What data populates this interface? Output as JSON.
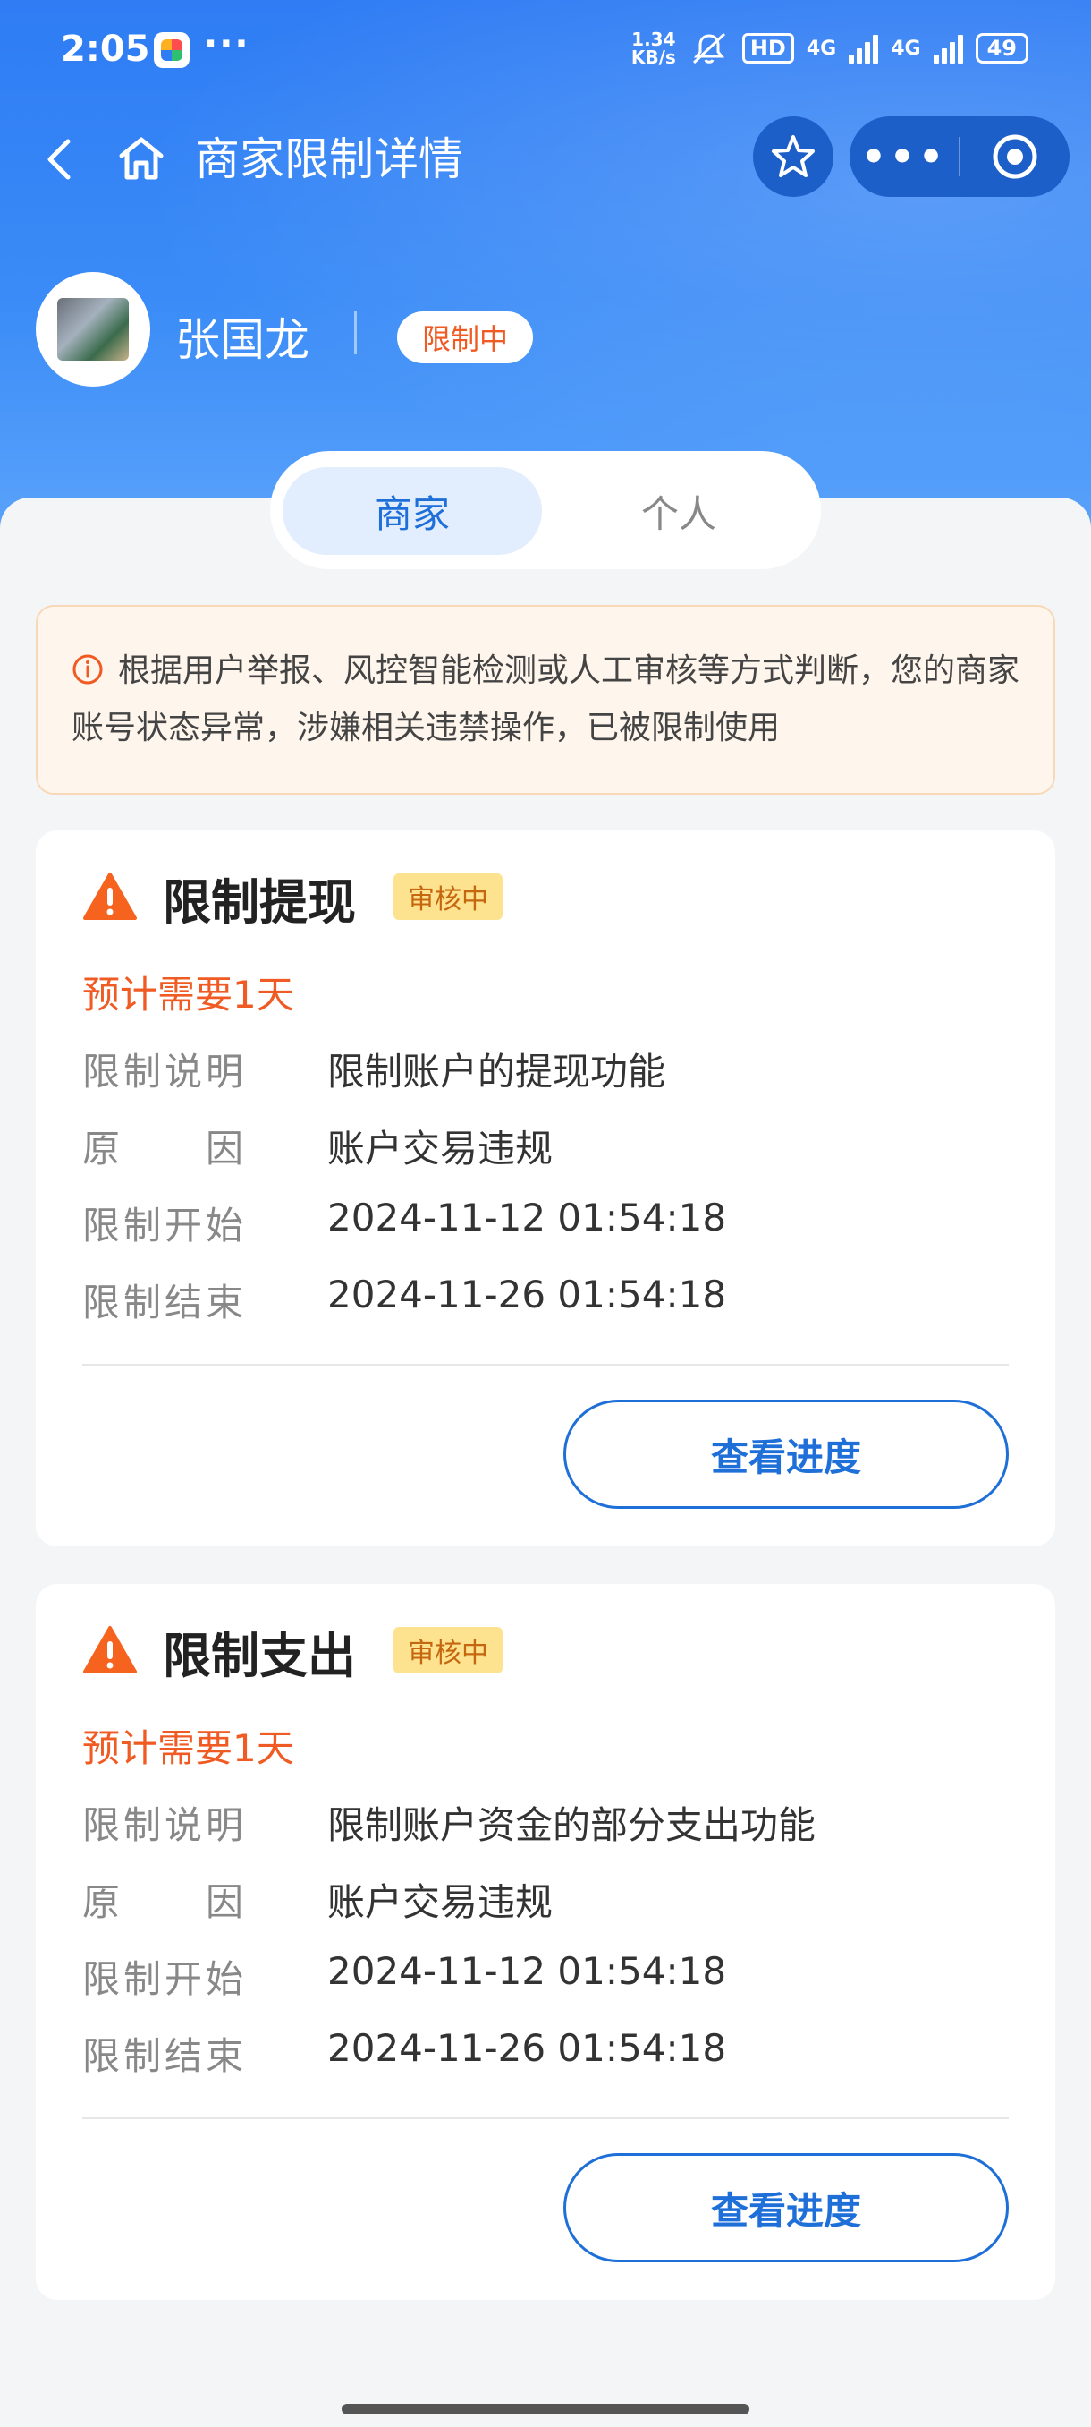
{
  "status_bar": {
    "time": "2:05",
    "more": "···",
    "net_speed_top": "1.34",
    "net_speed_bottom": "KB/s",
    "hd": "HD",
    "sig1": "4G",
    "sig2": "4G",
    "battery": "49"
  },
  "nav": {
    "title": "商家限制详情"
  },
  "user": {
    "name": "张国龙",
    "status_badge": "限制中"
  },
  "tabs": [
    {
      "label": "商家",
      "active": true
    },
    {
      "label": "个人",
      "active": false
    }
  ],
  "notice": {
    "text": "根据用户举报、风控智能检测或人工审核等方式判断，您的商家账号状态异常，涉嫌相关违禁操作，已被限制使用"
  },
  "cards": [
    {
      "title": "限制提现",
      "tag": "审核中",
      "eta": "预计需要1天",
      "rows": [
        {
          "k": "限制说明",
          "v": "限制账户的提现功能"
        },
        {
          "k": "原　　因",
          "v": "账户交易违规"
        },
        {
          "k": "限制开始",
          "v": "2024-11-12 01:54:18"
        },
        {
          "k": "限制结束",
          "v": "2024-11-26 01:54:18"
        }
      ],
      "button": "查看进度"
    },
    {
      "title": "限制支出",
      "tag": "审核中",
      "eta": "预计需要1天",
      "rows": [
        {
          "k": "限制说明",
          "v": "限制账户资金的部分支出功能"
        },
        {
          "k": "原　　因",
          "v": "账户交易违规"
        },
        {
          "k": "限制开始",
          "v": "2024-11-12 01:54:18"
        },
        {
          "k": "限制结束",
          "v": "2024-11-26 01:54:18"
        }
      ],
      "button": "查看进度"
    }
  ],
  "colors": {
    "brand_blue": "#2f7cf4",
    "link_blue": "#1f6fd9",
    "warning_orange": "#f05a23",
    "tag_yellow": "#fde28f"
  }
}
